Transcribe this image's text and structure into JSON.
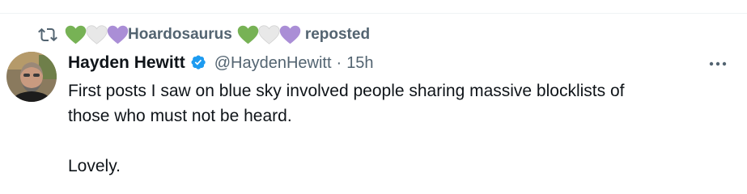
{
  "repost_header": {
    "reposter_name": "Hoardosaurus",
    "reposted_label": "reposted",
    "heart_colors": [
      "#77b255",
      "#e8e8e8",
      "#aa8ed6"
    ]
  },
  "post": {
    "author_name": "Hayden Hewitt",
    "author_handle": "@HaydenHewitt",
    "separator": "·",
    "timestamp": "15h",
    "text_lines": [
      "First posts I saw on blue sky involved people sharing massive blocklists of",
      "those who must not be heard.",
      "",
      "Lovely."
    ]
  },
  "icons": {
    "repost": "repost-icon",
    "verified": "verified-badge-icon",
    "more": "more-options-icon"
  },
  "colors": {
    "text_primary": "#0f1419",
    "text_secondary": "#536471",
    "verified_blue": "#1d9bf0",
    "divider": "#eff3f4"
  }
}
